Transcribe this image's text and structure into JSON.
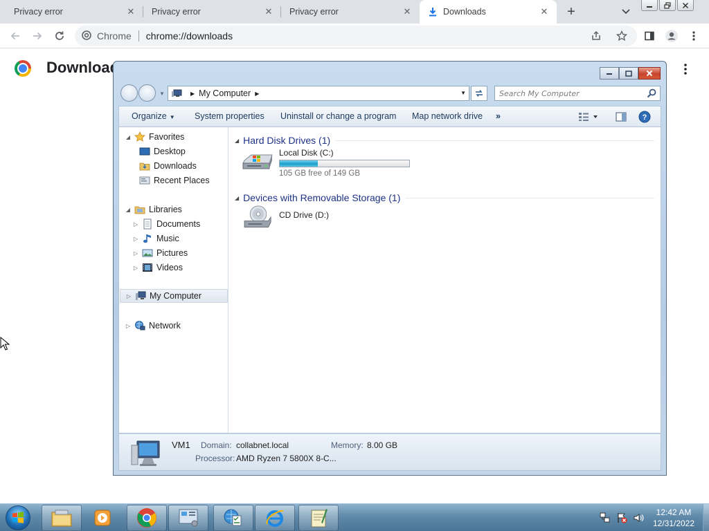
{
  "browser": {
    "tabs": [
      {
        "title": "Privacy error",
        "active": false
      },
      {
        "title": "Privacy error",
        "active": false
      },
      {
        "title": "Privacy error",
        "active": false
      },
      {
        "title": "Downloads",
        "active": true
      }
    ],
    "omnibox": {
      "site_label": "Chrome",
      "url": "chrome://downloads"
    },
    "page": {
      "title": "Downloads"
    }
  },
  "explorer": {
    "breadcrumb": "My Computer",
    "search_placeholder": "Search My Computer",
    "commands": {
      "organize": "Organize",
      "system_properties": "System properties",
      "uninstall": "Uninstall or change a program",
      "map_drive": "Map network drive",
      "overflow": "»"
    },
    "nav": {
      "favorites": "Favorites",
      "desktop": "Desktop",
      "downloads": "Downloads",
      "recent": "Recent Places",
      "libraries": "Libraries",
      "documents": "Documents",
      "music": "Music",
      "pictures": "Pictures",
      "videos": "Videos",
      "computer": "My Computer",
      "network": "Network"
    },
    "groups": {
      "hdd": "Hard Disk Drives (1)",
      "removable": "Devices with Removable Storage (1)"
    },
    "drives": {
      "c": {
        "name": "Local Disk (C:)",
        "free_text": "105 GB free of 149 GB",
        "used_fraction": 0.295
      },
      "d": {
        "name": "CD Drive (D:)"
      }
    },
    "details": {
      "name": "VM1",
      "domain_label": "Domain:",
      "domain_value": "collabnet.local",
      "memory_label": "Memory:",
      "memory_value": "8.00 GB",
      "processor_label": "Processor:",
      "processor_value": "AMD Ryzen 7 5800X 8-C..."
    }
  },
  "taskbar": {
    "time": "12:42 AM",
    "date": "12/31/2022",
    "apps": [
      "windows-explorer",
      "media-player",
      "chrome",
      "control-panel",
      "action-center-tool",
      "internet-explorer",
      "notepad-editor"
    ]
  },
  "colors": {
    "chrome_tabstrip": "#dee1e6",
    "explorer_frame": "#b6cde6",
    "group_header": "#1e3287",
    "drive_fill": "#1e9ec9",
    "taskbar": "#5f8aa9"
  }
}
